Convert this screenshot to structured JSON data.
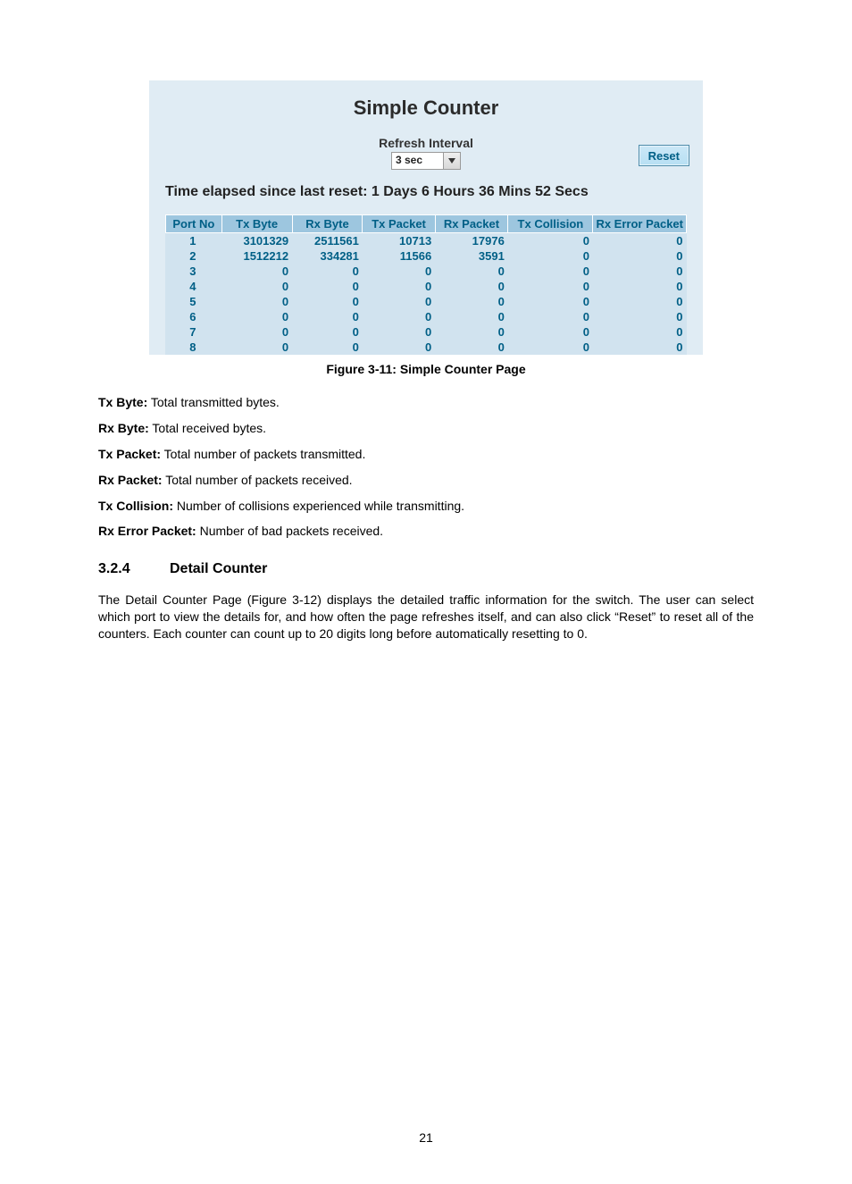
{
  "screenshot": {
    "title": "Simple Counter",
    "refresh_label": "Refresh Interval",
    "refresh_value": "3 sec",
    "reset_label": "Reset",
    "elapsed_label": "Time elapsed since last reset: 1 Days 6 Hours 36 Mins 52 Secs",
    "headers": {
      "port": "Port No",
      "tx_byte": "Tx Byte",
      "rx_byte": "Rx Byte",
      "tx_packet": "Tx Packet",
      "rx_packet": "Rx Packet",
      "tx_collision": "Tx Collision",
      "rx_error": "Rx Error Packet"
    },
    "rows": [
      {
        "port": "1",
        "tx_byte": "3101329",
        "rx_byte": "2511561",
        "tx_packet": "10713",
        "rx_packet": "17976",
        "tx_collision": "0",
        "rx_error": "0"
      },
      {
        "port": "2",
        "tx_byte": "1512212",
        "rx_byte": "334281",
        "tx_packet": "11566",
        "rx_packet": "3591",
        "tx_collision": "0",
        "rx_error": "0"
      },
      {
        "port": "3",
        "tx_byte": "0",
        "rx_byte": "0",
        "tx_packet": "0",
        "rx_packet": "0",
        "tx_collision": "0",
        "rx_error": "0"
      },
      {
        "port": "4",
        "tx_byte": "0",
        "rx_byte": "0",
        "tx_packet": "0",
        "rx_packet": "0",
        "tx_collision": "0",
        "rx_error": "0"
      },
      {
        "port": "5",
        "tx_byte": "0",
        "rx_byte": "0",
        "tx_packet": "0",
        "rx_packet": "0",
        "tx_collision": "0",
        "rx_error": "0"
      },
      {
        "port": "6",
        "tx_byte": "0",
        "rx_byte": "0",
        "tx_packet": "0",
        "rx_packet": "0",
        "tx_collision": "0",
        "rx_error": "0"
      },
      {
        "port": "7",
        "tx_byte": "0",
        "rx_byte": "0",
        "tx_packet": "0",
        "rx_packet": "0",
        "tx_collision": "0",
        "rx_error": "0"
      },
      {
        "port": "8",
        "tx_byte": "0",
        "rx_byte": "0",
        "tx_packet": "0",
        "rx_packet": "0",
        "tx_collision": "0",
        "rx_error": "0"
      }
    ]
  },
  "caption": "Figure 3-11: Simple Counter Page",
  "definitions": [
    {
      "term": "Tx Byte:",
      "desc": " Total transmitted bytes."
    },
    {
      "term": "Rx Byte:",
      "desc": " Total received bytes."
    },
    {
      "term": "Tx Packet:",
      "desc": " Total number of packets transmitted."
    },
    {
      "term": "Rx Packet:",
      "desc": " Total number of packets received."
    },
    {
      "term": "Tx Collision:",
      "desc": " Number of collisions experienced while transmitting."
    },
    {
      "term": "Rx Error Packet:",
      "desc": " Number of bad packets received."
    }
  ],
  "section": {
    "number": "3.2.4",
    "title": "Detail Counter",
    "paragraph": "The Detail Counter Page (Figure 3-12) displays the detailed traffic information for the switch. The user can select which port to view the details for, and how often the page refreshes itself, and can also click “Reset” to reset all of the counters. Each counter can count up to 20 digits long before automatically resetting to 0."
  },
  "page_number": "21"
}
